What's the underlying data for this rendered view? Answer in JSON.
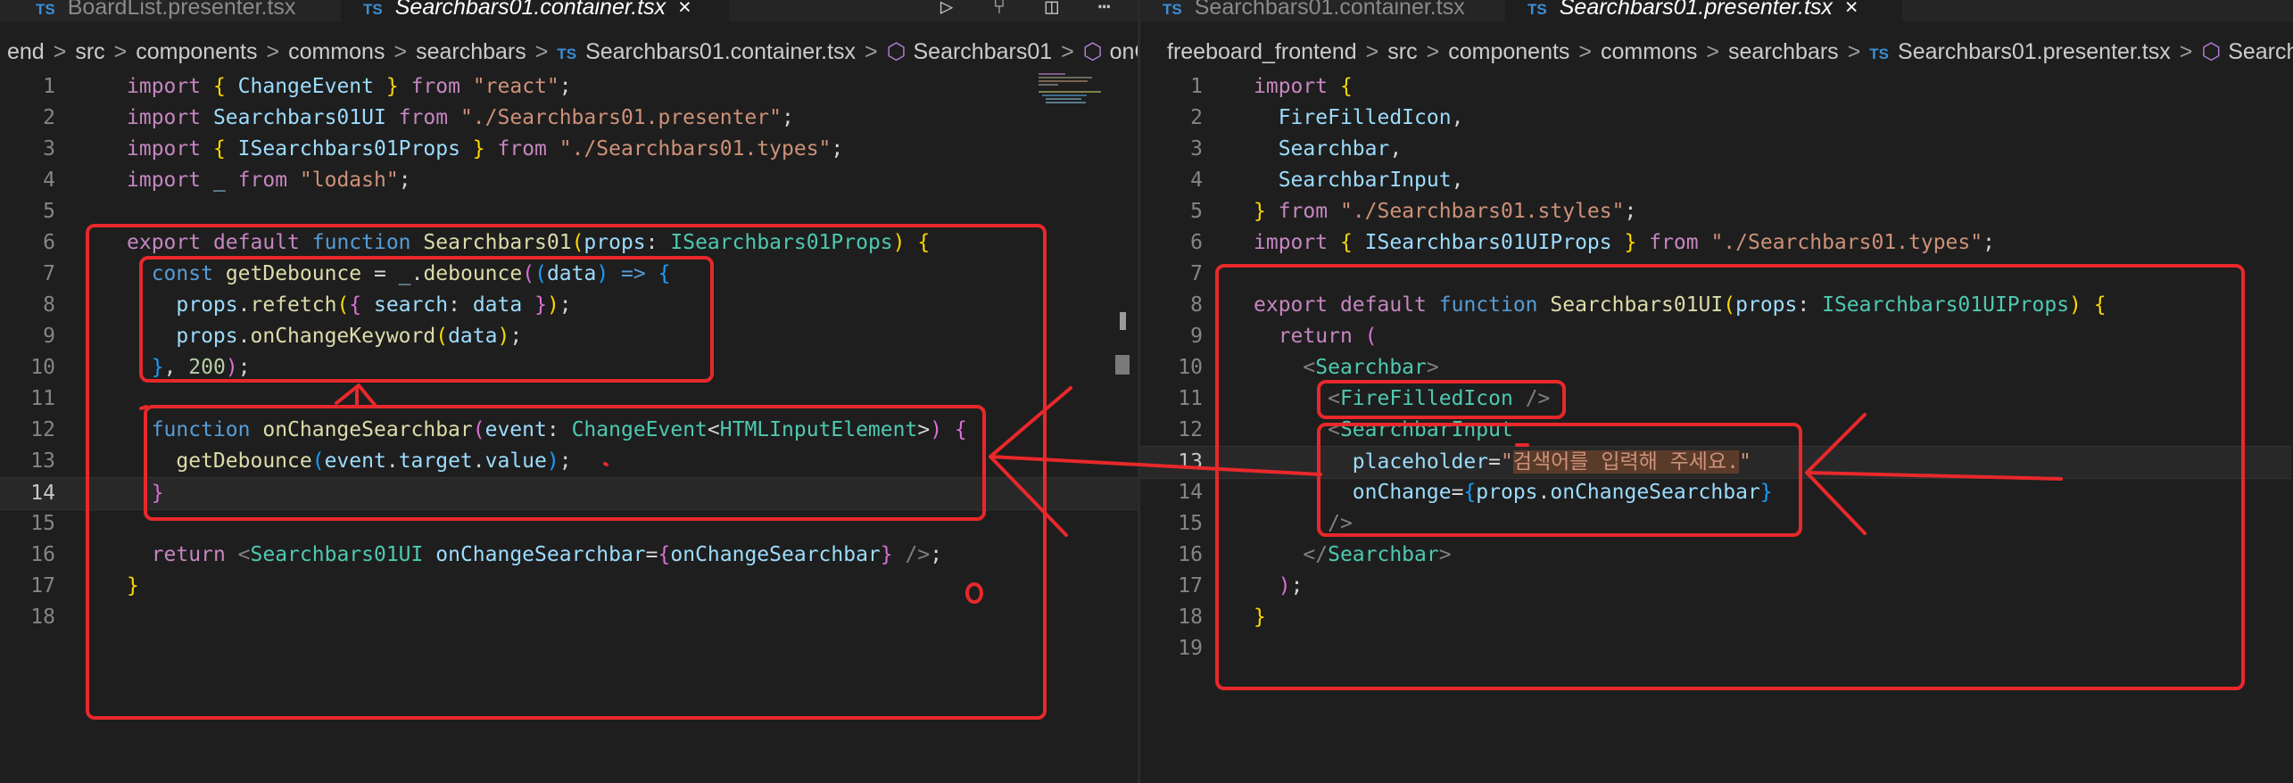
{
  "left": {
    "tabs": [
      {
        "label": "BoardList.presenter.tsx",
        "icon": "TS"
      },
      {
        "label": "Searchbars01.container.tsx",
        "icon": "TS",
        "active": true,
        "close": "×"
      }
    ],
    "actions": [
      "▷",
      "⑂",
      "◫",
      "⋯"
    ],
    "breadcrumb": [
      "end",
      "src",
      "components",
      "commons",
      "searchbars",
      "Searchbars01.container.tsx",
      "Searchbars01",
      "onCh"
    ],
    "current_line": 14
  },
  "right": {
    "tabs": [
      {
        "label": "Searchbars01.container.tsx",
        "icon": "TS"
      },
      {
        "label": "Searchbars01.presenter.tsx",
        "icon": "TS",
        "active": true,
        "close": "×"
      }
    ],
    "breadcrumb": [
      "freeboard_frontend",
      "src",
      "components",
      "commons",
      "searchbars",
      "Searchbars01.presenter.tsx",
      "Searchb"
    ],
    "current_line": 13
  },
  "annotation": {
    "mark_text": "0",
    "color": "#e8282b"
  },
  "colors": {
    "background": "#1e1e1e",
    "annotation_red": "#e8282b"
  }
}
